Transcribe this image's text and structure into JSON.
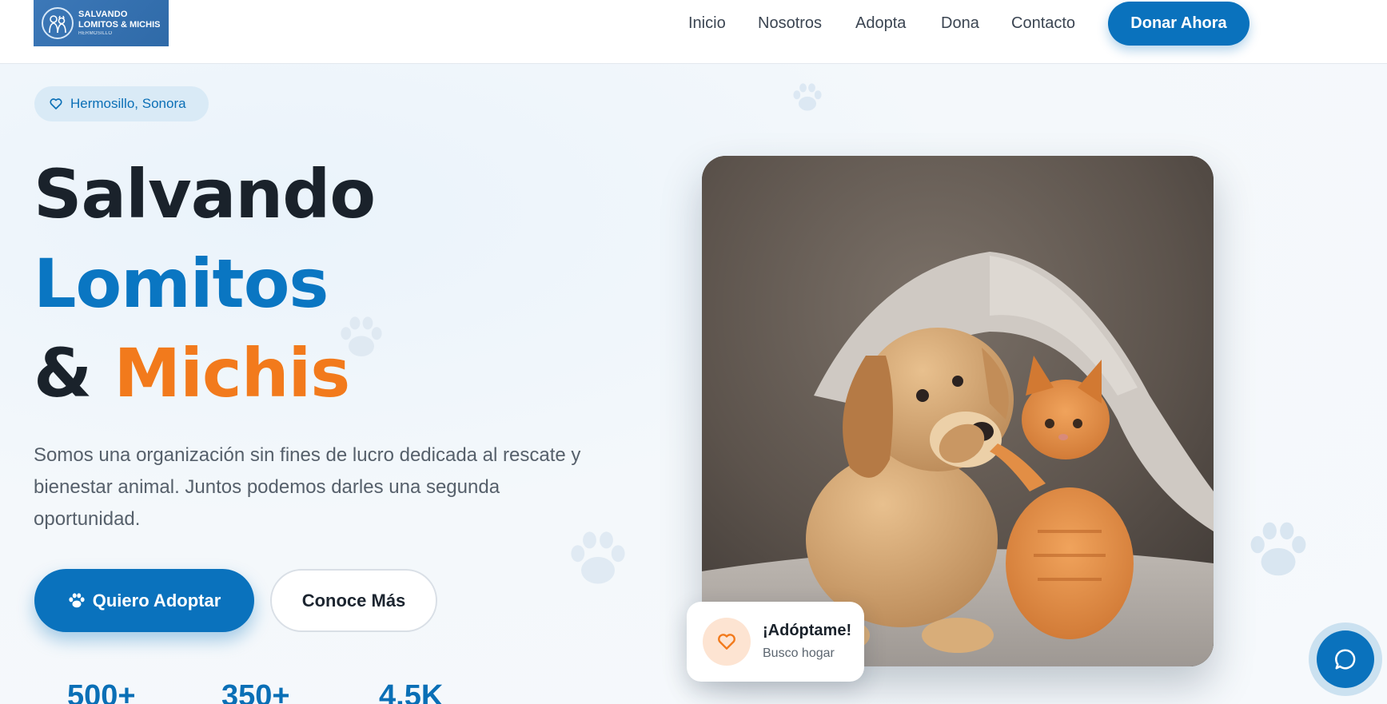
{
  "brand": {
    "logo_line1": "SALVANDO",
    "logo_line2": "LOMITOS & MICHIS",
    "logo_line3": "HERMOSILLO"
  },
  "nav": {
    "items": [
      {
        "label": "Inicio"
      },
      {
        "label": "Nosotros"
      },
      {
        "label": "Adopta"
      },
      {
        "label": "Dona"
      },
      {
        "label": "Contacto"
      }
    ],
    "cta": "Donar Ahora"
  },
  "hero": {
    "location": "Hermosillo, Sonora",
    "title_line1": "Salvando",
    "title_line2": "Lomitos",
    "title_amp": "&",
    "title_line3": "Michis",
    "description": "Somos una organización sin fines de lucro dedicada al rescate y bienestar animal. Juntos podemos darles una segunda oportunidad.",
    "primary_button": "Quiero Adoptar",
    "secondary_button": "Conoce Más",
    "stats": [
      {
        "value": "500+"
      },
      {
        "value": "350+"
      },
      {
        "value": "4.5K"
      }
    ]
  },
  "adopt_card": {
    "title": "¡Adóptame!",
    "subtitle": "Busco hogar"
  },
  "icons": {
    "location": "heart-icon",
    "adopt_button": "paw-icon",
    "adopt_card": "heart-icon",
    "chat": "chat-bubble-icon"
  },
  "colors": {
    "primary": "#0a72bd",
    "accent_orange": "#f27a1c",
    "dark": "#1a222b"
  }
}
